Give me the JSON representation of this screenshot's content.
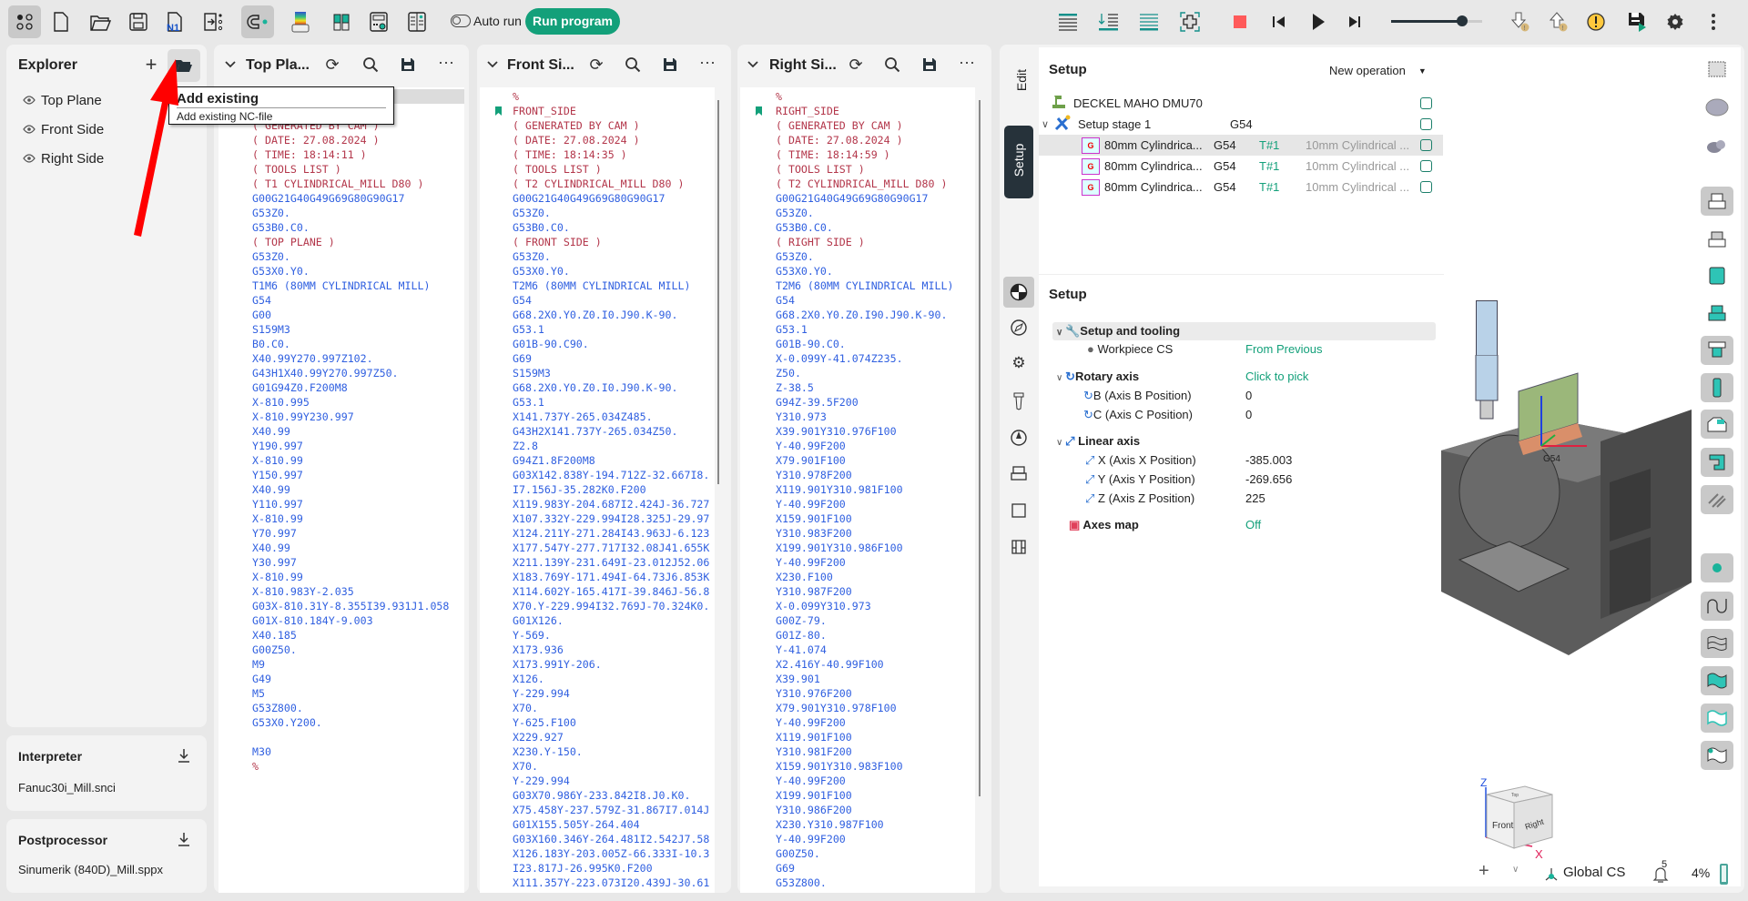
{
  "toolbar": {
    "auto_run_label": "Auto run",
    "auto_run_on": false,
    "run_program_label": "Run program",
    "accent": "#13a07a",
    "playback_slider": 0.78
  },
  "explorer": {
    "title": "Explorer",
    "items": [
      {
        "label": "Top Plane"
      },
      {
        "label": "Front Side"
      },
      {
        "label": "Right Side"
      }
    ]
  },
  "tooltip": {
    "title": "Add existing",
    "description": "Add existing NC-file"
  },
  "interpreter": {
    "title": "Interpreter",
    "value": "Fanuc30i_Mill.snci"
  },
  "postprocessor": {
    "title": "Postprocessor",
    "value": "Sinumerik (840D)_Mill.sppx"
  },
  "editors": [
    {
      "title": "Top Pla...",
      "current_line": 1,
      "bookmark_line": null,
      "lines": [
        "",
        "",
        "( GENERATED BY CAM )",
        "( DATE: 27.08.2024 )",
        "( TIME: 18:14:11 )",
        "( TOOLS LIST )",
        "( T1 CYLINDRICAL_MILL D80 )",
        "G00G21G40G49G69G80G90G17",
        "G53Z0.",
        "G53B0.C0.",
        "( TOP PLANE )",
        "G53Z0.",
        "G53X0.Y0.",
        "T1M6 (80MM CYLINDRICAL MILL)",
        "G54",
        "G00",
        "S159M3",
        "B0.C0.",
        "X40.99Y270.997Z102.",
        "G43H1X40.99Y270.997Z50.",
        "G01G94Z0.F200M8",
        "X-810.995",
        "X-810.99Y230.997",
        "X40.99",
        "Y190.997",
        "X-810.99",
        "Y150.997",
        "X40.99",
        "Y110.997",
        "X-810.99",
        "Y70.997",
        "X40.99",
        "Y30.997",
        "X-810.99",
        "X-810.983Y-2.035",
        "G03X-810.31Y-8.355I39.931J1.058",
        "G01X-810.184Y-9.003",
        "X40.185",
        "G00Z50.",
        "M9",
        "G49",
        "M5",
        "G53Z800.",
        "G53X0.Y200.",
        "",
        "M30",
        "%"
      ]
    },
    {
      "title": "Front Si...",
      "current_line": null,
      "bookmark_line": 2,
      "lines": [
        "%",
        "FRONT_SIDE",
        "( GENERATED BY CAM )",
        "( DATE: 27.08.2024 )",
        "( TIME: 18:14:35 )",
        "( TOOLS LIST )",
        "( T2 CYLINDRICAL_MILL D80 )",
        "G00G21G40G49G69G80G90G17",
        "G53Z0.",
        "G53B0.C0.",
        "( FRONT SIDE )",
        "G53Z0.",
        "G53X0.Y0.",
        "T2M6 (80MM CYLINDRICAL MILL)",
        "G54",
        "G68.2X0.Y0.Z0.I0.J90.K-90.",
        "G53.1",
        "G01B-90.C90.",
        "G69",
        "S159M3",
        "G68.2X0.Y0.Z0.I0.J90.K-90.",
        "G53.1",
        "X141.737Y-265.034Z485.",
        "G43H2X141.737Y-265.034Z50.",
        "Z2.8",
        "G94Z1.8F200M8",
        "G03X142.838Y-194.712Z-32.667I8.",
        "I7.156J-35.282K0.F200",
        "X119.983Y-204.687I2.424J-36.727",
        "X107.332Y-229.994I28.325J-29.97",
        "X124.211Y-271.284I43.963J-6.123",
        "X177.547Y-277.717I32.08J41.655K",
        "X211.139Y-231.649I-23.012J52.06",
        "X183.769Y-171.494I-64.73J6.853K",
        "X114.602Y-165.417I-39.846J-56.8",
        "X70.Y-229.994I32.769J-70.324K0.",
        "G01X126.",
        "Y-569.",
        "X173.936",
        "X173.991Y-206.",
        "X126.",
        "Y-229.994",
        "X70.",
        "Y-625.F100",
        "X229.927",
        "X230.Y-150.",
        "X70.",
        "Y-229.994",
        "G03X70.986Y-233.842I8.J0.K0.",
        "X75.458Y-237.579Z-31.867I7.014J",
        "G01X155.505Y-264.404",
        "G03X160.346Y-264.481I2.542J7.58",
        "X126.183Y-203.005Z-66.333I-10.3",
        "I23.817J-26.995K0.F200",
        "X111.357Y-223.073I20.439J-30.61"
      ]
    },
    {
      "title": "Right Si...",
      "current_line": null,
      "bookmark_line": 2,
      "lines": [
        "%",
        "RIGHT_SIDE",
        "( GENERATED BY CAM )",
        "( DATE: 27.08.2024 )",
        "( TIME: 18:14:59 )",
        "( TOOLS LIST )",
        "( T2 CYLINDRICAL_MILL D80 )",
        "G00G21G40G49G69G80G90G17",
        "G53Z0.",
        "G53B0.C0.",
        "( RIGHT SIDE )",
        "G53Z0.",
        "G53X0.Y0.",
        "T2M6 (80MM CYLINDRICAL MILL)",
        "G54",
        "G68.2X0.Y0.Z0.I90.J90.K-90.",
        "G53.1",
        "G01B-90.C0.",
        "X-0.099Y-41.074Z235.",
        "Z50.",
        "Z-38.5",
        "G94Z-39.5F200",
        "Y310.973",
        "X39.901Y310.976F100",
        "Y-40.99F200",
        "X79.901F100",
        "Y310.978F200",
        "X119.901Y310.981F100",
        "Y-40.99F200",
        "X159.901F100",
        "Y310.983F200",
        "X199.901Y310.986F100",
        "Y-40.99F200",
        "X230.F100",
        "Y310.987F200",
        "X-0.099Y310.973",
        "G00Z-79.",
        "G01Z-80.",
        "Y-41.074",
        "X2.416Y-40.99F100",
        "X39.901",
        "Y310.976F200",
        "X79.901Y310.978F100",
        "Y-40.99F200",
        "X119.901F100",
        "Y310.981F200",
        "X159.901Y310.983F100",
        "Y-40.99F200",
        "X199.901F100",
        "Y310.986F200",
        "X230.Y310.987F100",
        "Y-40.99F200",
        "G00Z50.",
        "G69",
        "G53Z800."
      ]
    }
  ],
  "side_tabs": {
    "edit": "Edit",
    "setup": "Setup"
  },
  "setup_tree": {
    "title": "Setup",
    "new_operation_label": "New operation",
    "machine": "DECKEL MAHO DMU70",
    "stage": {
      "label": "Setup stage 1",
      "cs": "G54"
    },
    "operations": [
      {
        "name": "80mm Cylindrica...",
        "cs": "G54",
        "tool_num": "T#1",
        "tool": "10mm Cylindrical ...",
        "selected": true
      },
      {
        "name": "80mm Cylindrica...",
        "cs": "G54",
        "tool_num": "T#1",
        "tool": "10mm Cylindrical ...",
        "selected": false
      },
      {
        "name": "80mm Cylindrica...",
        "cs": "G54",
        "tool_num": "T#1",
        "tool": "10mm Cylindrical ...",
        "selected": false
      }
    ]
  },
  "setup_props": {
    "title": "Setup",
    "group_setup": "Setup and tooling",
    "workpiece_cs": {
      "label": "Workpiece CS",
      "value": "From Previous"
    },
    "rotary": {
      "label": "Rotary axis",
      "value": "Click to pick"
    },
    "b_axis": {
      "label": "B (Axis B Position)",
      "value": "0"
    },
    "c_axis": {
      "label": "C (Axis C Position)",
      "value": "0"
    },
    "linear": {
      "label": "Linear axis"
    },
    "x_axis": {
      "label": "X (Axis X Position)",
      "value": "-385.003"
    },
    "y_axis": {
      "label": "Y (Axis Y Position)",
      "value": "-269.656"
    },
    "z_axis": {
      "label": "Z (Axis Z Position)",
      "value": "225"
    },
    "axes_map": {
      "label": "Axes map",
      "value": "Off"
    }
  },
  "viewport": {
    "cs_label": "G54",
    "cube": {
      "front": "Front",
      "right": "Right",
      "top": "Top",
      "z": "Z",
      "x": "X"
    },
    "status": {
      "cs": "Global CS",
      "notifications": "5",
      "progress": "4%"
    }
  }
}
